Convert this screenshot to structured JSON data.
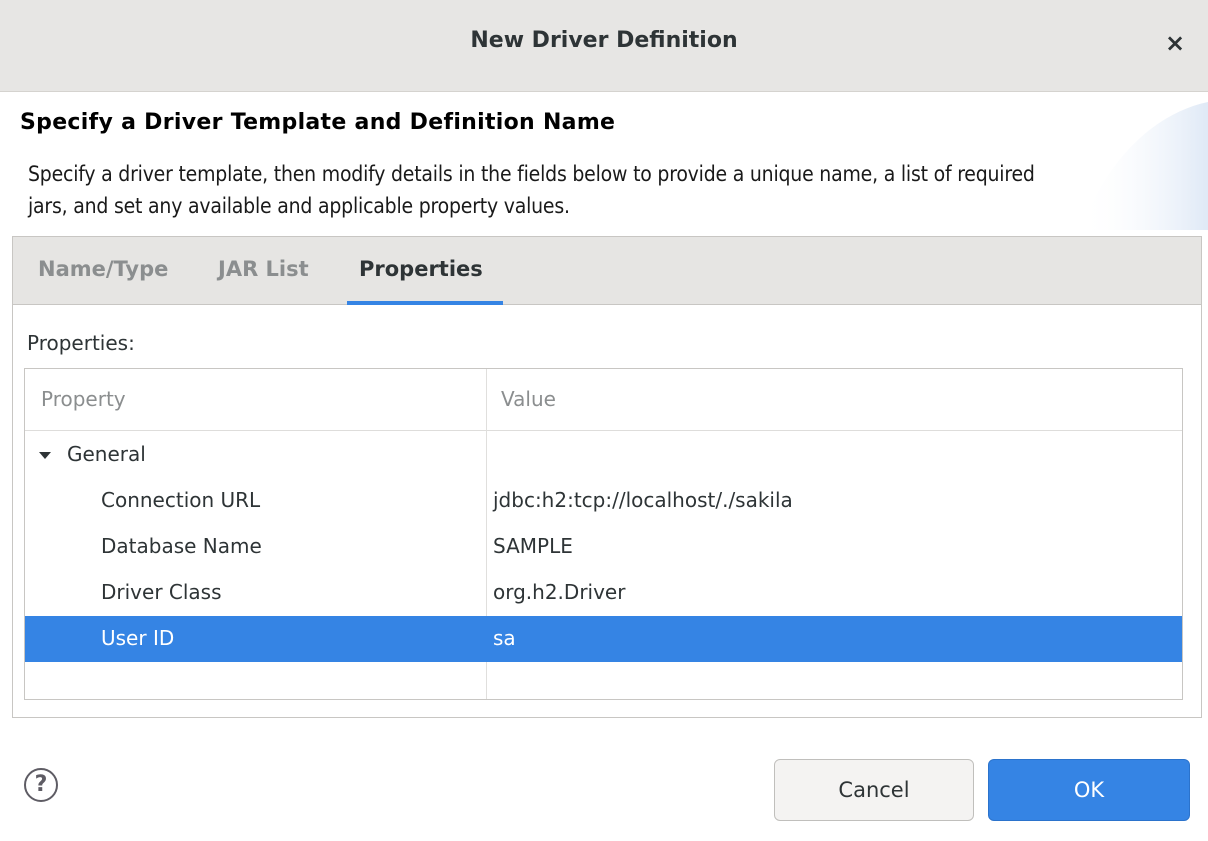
{
  "dialog": {
    "title": "New Driver Definition",
    "close_symbol": "×"
  },
  "header": {
    "heading": "Specify a Driver Template and Definition Name",
    "description": "Specify a driver template, then modify details in the fields below to provide a unique name, a list of required jars, and set any available and applicable property values."
  },
  "tabs": [
    {
      "label": "Name/Type",
      "active": false
    },
    {
      "label": "JAR List",
      "active": false
    },
    {
      "label": "Properties",
      "active": true
    }
  ],
  "properties": {
    "label": "Properties:",
    "columns": [
      "Property",
      "Value"
    ],
    "group": {
      "label": "General",
      "expanded": true
    },
    "rows": [
      {
        "property": "Connection URL",
        "value": "jdbc:h2:tcp://localhost/./sakila",
        "selected": false
      },
      {
        "property": "Database Name",
        "value": "SAMPLE",
        "selected": false
      },
      {
        "property": "Driver Class",
        "value": "org.h2.Driver",
        "selected": false
      },
      {
        "property": "User ID",
        "value": "sa",
        "selected": true
      }
    ]
  },
  "footer": {
    "help_symbol": "?",
    "cancel_label": "Cancel",
    "ok_label": "OK"
  },
  "colors": {
    "accent": "#3584e4",
    "titlebar": "#e7e6e4",
    "tab_strip": "#e6e5e3"
  },
  "icons": {
    "close": "close-icon",
    "expander": "triangle-down-icon",
    "help": "help-circle-icon"
  }
}
